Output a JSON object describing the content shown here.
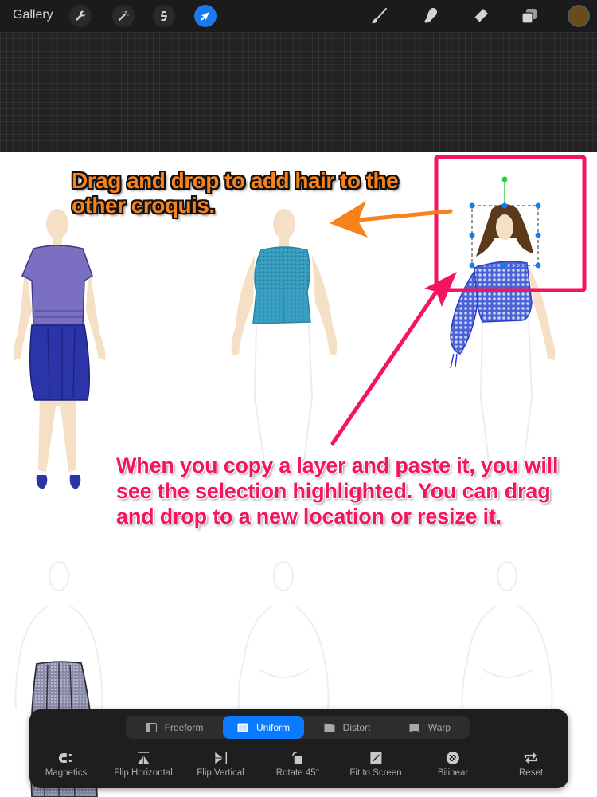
{
  "topbar": {
    "gallery_label": "Gallery",
    "left_tools": [
      {
        "name": "actions",
        "icon": "wrench-icon",
        "active": false
      },
      {
        "name": "adjustments",
        "icon": "magic-wand-icon",
        "active": false
      },
      {
        "name": "selection",
        "icon": "selection-s-icon",
        "active": false
      },
      {
        "name": "transform",
        "icon": "arrow-cursor-icon",
        "active": true
      }
    ],
    "right_tools": [
      {
        "name": "paint",
        "icon": "brush-icon"
      },
      {
        "name": "smudge",
        "icon": "smudge-finger-icon"
      },
      {
        "name": "erase",
        "icon": "eraser-icon"
      },
      {
        "name": "layers",
        "icon": "layers-icon"
      }
    ],
    "current_color": "#6b4a1c"
  },
  "canvas": {
    "annotation_top": "Drag and drop to add hair to the other croquis.",
    "annotation_bottom": "When you copy a layer and paste it, you will see the selection highlighted.  You can drag and drop to a new location or resize it.",
    "colors": {
      "annotation_orange": "#f7821b",
      "annotation_pink": "#f5145f",
      "highlight_box": "#f5145f",
      "selection_handle": "#1a7bf0",
      "rotation_handle": "#2ecc40",
      "skin": "#f5dfc5",
      "hair": "#5a3a1a"
    },
    "figures": [
      {
        "name": "croquis-purple-top-navy-skirt",
        "outfit": "purple cap-sleeve top, navy pencil skirt, navy shoes"
      },
      {
        "name": "croquis-teal-top",
        "outfit": "teal sleeveless lace top"
      },
      {
        "name": "croquis-blue-one-shoulder-top-with-hair",
        "outfit": "blue floral one-shoulder top, brown hair (pasted selection)"
      },
      {
        "name": "croquis-grey-skirt",
        "outfit": "grey tweed skirt"
      },
      {
        "name": "croquis-blank-2",
        "outfit": ""
      },
      {
        "name": "croquis-blank-3",
        "outfit": ""
      }
    ]
  },
  "transform_panel": {
    "modes": [
      {
        "label": "Freeform",
        "icon": "freeform-icon",
        "active": false
      },
      {
        "label": "Uniform",
        "icon": "uniform-icon",
        "active": true
      },
      {
        "label": "Distort",
        "icon": "distort-icon",
        "active": false
      },
      {
        "label": "Warp",
        "icon": "warp-icon",
        "active": false
      }
    ],
    "actions": [
      {
        "label": "Magnetics",
        "icon": "magnet-icon"
      },
      {
        "label": "Flip Horizontal",
        "icon": "flip-horizontal-icon"
      },
      {
        "label": "Flip Vertical",
        "icon": "flip-vertical-icon"
      },
      {
        "label": "Rotate 45°",
        "icon": "rotate-icon"
      },
      {
        "label": "Fit to Screen",
        "icon": "fit-to-screen-icon"
      },
      {
        "label": "Bilinear",
        "icon": "bilinear-icon"
      },
      {
        "label": "Reset",
        "icon": "reset-icon"
      }
    ]
  }
}
